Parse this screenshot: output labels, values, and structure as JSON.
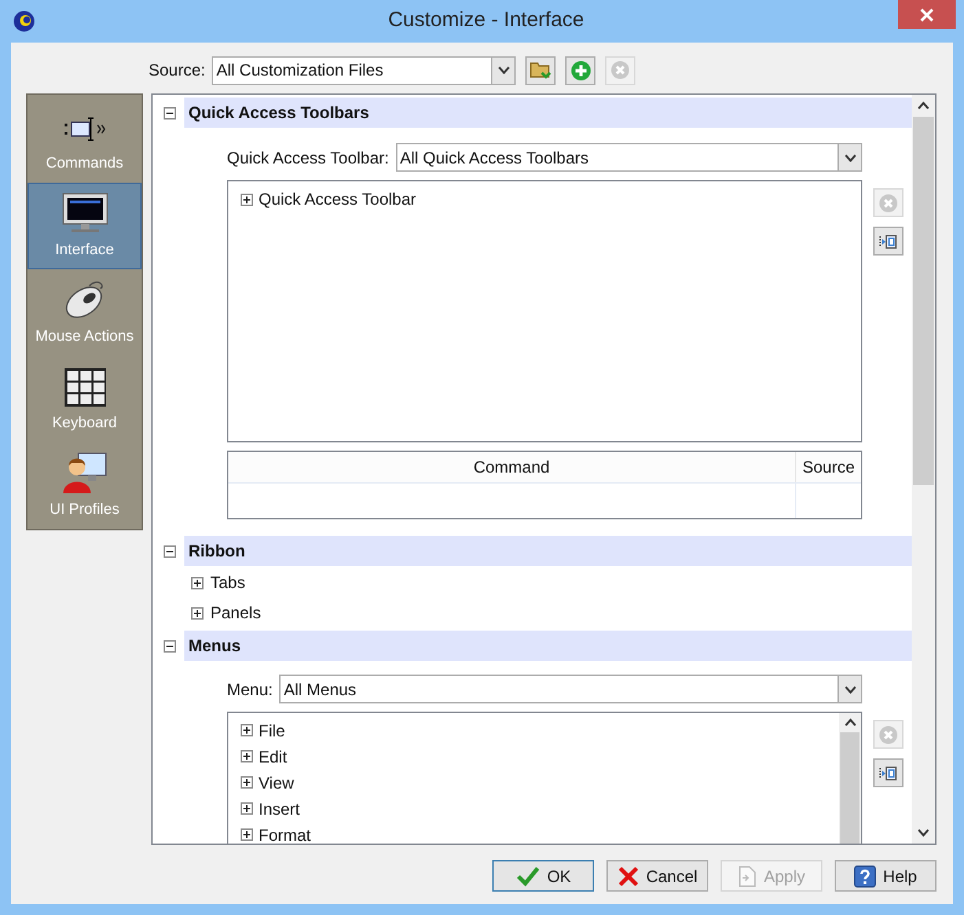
{
  "window": {
    "title": "Customize - Interface"
  },
  "source": {
    "label": "Source:",
    "value": "All Customization Files",
    "buttons": [
      {
        "disabled": false
      },
      {
        "disabled": false
      },
      {
        "disabled": true
      }
    ]
  },
  "sidebar": {
    "items": [
      {
        "label": "Commands",
        "selected": false
      },
      {
        "label": "Interface",
        "selected": true
      },
      {
        "label": "Mouse Actions",
        "selected": false
      },
      {
        "label": "Keyboard",
        "selected": false
      },
      {
        "label": "UI Profiles",
        "selected": false
      }
    ]
  },
  "sections": [
    {
      "kind": "toolbars",
      "title": "Quick Access Toolbars",
      "expanded": true,
      "field": {
        "label": "Quick Access Toolbar:",
        "value": "All Quick Access Toolbars"
      },
      "tree": [
        {
          "label": "Quick Access Toolbar",
          "expanded": false
        }
      ],
      "side_buttons": [
        {
          "disabled": true
        },
        {
          "disabled": false
        }
      ],
      "table": {
        "columns": [
          "Command",
          "Source"
        ]
      }
    },
    {
      "kind": "tree",
      "title": "Ribbon",
      "expanded": true,
      "children": [
        {
          "label": "Tabs",
          "expanded": false
        },
        {
          "label": "Panels",
          "expanded": false
        }
      ]
    },
    {
      "kind": "menus",
      "title": "Menus",
      "expanded": true,
      "field": {
        "label": "Menu:",
        "value": "All Menus"
      },
      "tree": [
        {
          "label": "File",
          "expanded": false
        },
        {
          "label": "Edit",
          "expanded": false
        },
        {
          "label": "View",
          "expanded": false
        },
        {
          "label": "Insert",
          "expanded": false
        },
        {
          "label": "Format",
          "expanded": false
        }
      ],
      "side_buttons": [
        {
          "disabled": true
        },
        {
          "disabled": false
        }
      ]
    }
  ],
  "buttons": [
    {
      "label": "OK",
      "kind": "ok",
      "disabled": false
    },
    {
      "label": "Cancel",
      "kind": "cancel",
      "disabled": false
    },
    {
      "label": "Apply",
      "kind": "apply",
      "disabled": true
    },
    {
      "label": "Help",
      "kind": "help",
      "disabled": false
    }
  ]
}
